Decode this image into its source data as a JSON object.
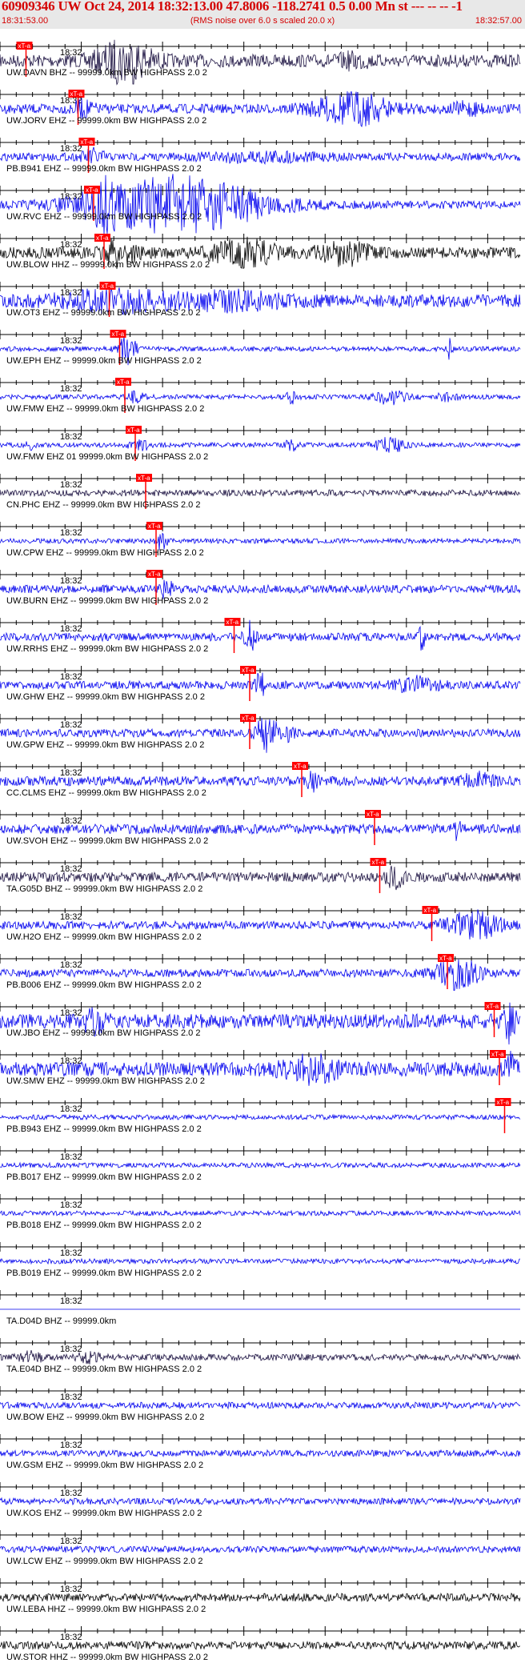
{
  "header": {
    "title": "60909346 UW Oct 24, 2014 18:32:13.00   47.8006 -118.2741  0.5 0.00 Mn st --- -- --  -1",
    "start_time": "18:31:53.00",
    "subtitle": "(RMS noise over 6.0 s scaled 20.0 x)",
    "end_time": "18:32:57.00"
  },
  "colors": {
    "pick": "#ff0000",
    "blue": "#0000ee",
    "dark": "#1a1040",
    "black": "#000000",
    "label": "#000000"
  },
  "chart_data": {
    "type": "line",
    "time_range": [
      "18:31:53.00",
      "18:32:57.00"
    ],
    "tick_label": "18:32",
    "pick_label": "xT-a",
    "series": [
      {
        "station": "UW.DAVN BHZ -- 99999.0km BW  HIGHPASS  2.0  2",
        "color": "dark",
        "pick": 0.05,
        "amp": 8,
        "events": [
          [
            0.24,
            24,
            0.05
          ],
          [
            0.68,
            6,
            0.03
          ]
        ]
      },
      {
        "station": "UW.JORV EHZ -- 99999.0km BW  HIGHPASS  2.0  2",
        "color": "blue",
        "pick": 0.15,
        "amp": 6,
        "events": [
          [
            0.16,
            8,
            0.02
          ],
          [
            0.68,
            18,
            0.07
          ],
          [
            0.9,
            6,
            0.03
          ]
        ]
      },
      {
        "station": "PB.B941 EHZ -- 99999.0km BW  HIGHPASS  2.0  2",
        "color": "blue",
        "pick": 0.17,
        "amp": 5,
        "events": [
          [
            0.18,
            8,
            0.02
          ],
          [
            0.5,
            5,
            0.1
          ]
        ]
      },
      {
        "station": "UW.RVC EHZ -- 99999.0km BW  HIGHPASS  2.0  2",
        "color": "blue",
        "pick": 0.18,
        "amp": 5,
        "events": [
          [
            0.34,
            34,
            0.16
          ],
          [
            0.2,
            20,
            0.03
          ]
        ]
      },
      {
        "station": "UW.BLOW HHZ -- 99999.0km BW  HIGHPASS  2.0  2",
        "color": "black",
        "pick": 0.2,
        "amp": 7,
        "events": [
          [
            0.23,
            16,
            0.03
          ],
          [
            0.47,
            14,
            0.06
          ],
          [
            0.66,
            12,
            0.05
          ]
        ]
      },
      {
        "station": "UW.OT3 EHZ -- 99999.0km BW  HIGHPASS  2.0  2",
        "color": "blue",
        "pick": 0.21,
        "amp": 8,
        "events": [
          [
            0.22,
            10,
            0.1
          ],
          [
            0.45,
            8,
            0.1
          ]
        ]
      },
      {
        "station": "UW.EPH EHZ -- 99999.0km BW  HIGHPASS  2.0  2",
        "color": "blue",
        "pick": 0.23,
        "amp": 3,
        "events": [
          [
            0.245,
            20,
            0.015
          ],
          [
            0.865,
            24,
            0.004
          ]
        ]
      },
      {
        "station": "UW.FMW EHZ -- 99999.0km BW  HIGHPASS  2.0  2",
        "color": "blue",
        "pick": 0.24,
        "amp": 3,
        "events": [
          [
            0.26,
            6,
            0.02
          ],
          [
            0.56,
            7,
            0.01
          ],
          [
            0.75,
            8,
            0.03
          ],
          [
            0.86,
            5,
            0.02
          ]
        ]
      },
      {
        "station": "UW.FMW EHZ 01 99999.0km BW  HIGHPASS  2.0  2",
        "color": "blue",
        "pick": 0.26,
        "amp": 3,
        "events": [
          [
            0.27,
            6,
            0.02
          ],
          [
            0.56,
            7,
            0.01
          ],
          [
            0.75,
            8,
            0.03
          ],
          [
            0.06,
            5,
            0.01
          ]
        ]
      },
      {
        "station": "CN.PHC EHZ -- 99999.0km BW  HIGHPASS  2.0  2",
        "color": "dark",
        "pick": 0.28,
        "amp": 4,
        "events": []
      },
      {
        "station": "UW.CPW EHZ -- 99999.0km BW  HIGHPASS  2.0  2",
        "color": "blue",
        "pick": 0.3,
        "amp": 3,
        "events": [
          [
            0.31,
            10,
            0.01
          ]
        ]
      },
      {
        "station": "UW.BURN EHZ -- 99999.0km BW  HIGHPASS  2.0  2",
        "color": "blue",
        "pick": 0.3,
        "amp": 5,
        "events": [
          [
            0.32,
            12,
            0.01
          ]
        ]
      },
      {
        "station": "UW.RRHS EHZ -- 99999.0km BW  HIGHPASS  2.0  2",
        "color": "blue",
        "pick": 0.45,
        "amp": 5,
        "events": [
          [
            0.48,
            18,
            0.01
          ],
          [
            0.81,
            16,
            0.006
          ]
        ]
      },
      {
        "station": "UW.GHW EHZ -- 99999.0km BW  HIGHPASS  2.0  2",
        "color": "blue",
        "pick": 0.48,
        "amp": 5,
        "events": [
          [
            0.5,
            16,
            0.008
          ],
          [
            0.8,
            8,
            0.04
          ]
        ]
      },
      {
        "station": "UW.GPW EHZ -- 99999.0km BW  HIGHPASS  2.0  2",
        "color": "blue",
        "pick": 0.48,
        "amp": 5,
        "events": [
          [
            0.51,
            20,
            0.02
          ],
          [
            0.55,
            8,
            0.02
          ]
        ]
      },
      {
        "station": "CC.CLMS EHZ -- 99999.0km BW  HIGHPASS  2.0  2",
        "color": "blue",
        "pick": 0.58,
        "amp": 6,
        "events": [
          [
            0.6,
            10,
            0.01
          ],
          [
            0.92,
            8,
            0.03
          ]
        ]
      },
      {
        "station": "UW.SVOH EHZ -- 99999.0km BW  HIGHPASS  2.0  2",
        "color": "blue",
        "pick": 0.72,
        "amp": 6,
        "events": [
          [
            0.88,
            10,
            0.01
          ]
        ]
      },
      {
        "station": "TA.G05D BHZ -- 99999.0km BW  HIGHPASS  2.0  2",
        "color": "dark",
        "pick": 0.73,
        "amp": 6,
        "events": [
          [
            0.76,
            12,
            0.02
          ]
        ]
      },
      {
        "station": "UW.H2O EHZ -- 99999.0km BW  HIGHPASS  2.0  2",
        "color": "blue",
        "pick": 0.83,
        "amp": 5,
        "events": [
          [
            0.91,
            16,
            0.05
          ]
        ]
      },
      {
        "station": "PB.B006 EHZ -- 99999.0km BW  HIGHPASS  2.0  2",
        "color": "blue",
        "pick": 0.86,
        "amp": 5,
        "events": [
          [
            0.88,
            18,
            0.04
          ]
        ]
      },
      {
        "station": "UW.JBO EHZ -- 99999.0km BW  HIGHPASS  2.0  2",
        "color": "blue",
        "pick": 0.95,
        "amp": 9,
        "events": [
          [
            0.18,
            14,
            0.02
          ],
          [
            0.98,
            22,
            0.01
          ]
        ]
      },
      {
        "station": "UW.SMW EHZ -- 99999.0km BW  HIGHPASS  2.0  2",
        "color": "blue",
        "pick": 0.96,
        "amp": 9,
        "events": [
          [
            0.6,
            12,
            0.05
          ],
          [
            0.98,
            20,
            0.01
          ]
        ]
      },
      {
        "station": "PB.B943 EHZ -- 99999.0km BW  HIGHPASS  2.0  2",
        "color": "blue",
        "pick": 0.97,
        "amp": 3,
        "events": []
      },
      {
        "station": "PB.B017 EHZ -- 99999.0km BW  HIGHPASS  2.0  2",
        "color": "blue",
        "pick": null,
        "amp": 3,
        "events": []
      },
      {
        "station": "PB.B018 EHZ -- 99999.0km BW  HIGHPASS  2.0  2",
        "color": "blue",
        "pick": null,
        "amp": 3,
        "events": []
      },
      {
        "station": "PB.B019 EHZ -- 99999.0km BW  HIGHPASS  2.0  2",
        "color": "blue",
        "pick": null,
        "amp": 3,
        "events": []
      },
      {
        "station": "TA.D04D BHZ -- 99999.0km",
        "color": "blue",
        "pick": null,
        "amp": 0,
        "events": []
      },
      {
        "station": "TA.E04D BHZ -- 99999.0km BW  HIGHPASS  2.0  2",
        "color": "dark",
        "pick": null,
        "amp": 4,
        "events": [
          [
            0.06,
            6,
            0.02
          ],
          [
            0.17,
            6,
            0.02
          ]
        ]
      },
      {
        "station": "UW.BOW EHZ -- 99999.0km BW  HIGHPASS  2.0  2",
        "color": "blue",
        "pick": null,
        "amp": 4,
        "events": []
      },
      {
        "station": "UW.GSM EHZ -- 99999.0km BW  HIGHPASS  2.0  2",
        "color": "blue",
        "pick": null,
        "amp": 4,
        "events": []
      },
      {
        "station": "UW.KOS EHZ -- 99999.0km BW  HIGHPASS  2.0  2",
        "color": "blue",
        "pick": null,
        "amp": 4,
        "events": []
      },
      {
        "station": "UW.LCW EHZ -- 99999.0km BW  HIGHPASS  2.0  2",
        "color": "blue",
        "pick": null,
        "amp": 4,
        "events": []
      },
      {
        "station": "UW.LEBA HHZ -- 99999.0km BW  HIGHPASS  2.0  2",
        "color": "black",
        "pick": null,
        "amp": 5,
        "events": []
      },
      {
        "station": "UW.STOR HHZ -- 99999.0km BW  HIGHPASS  2.0  2",
        "color": "black",
        "pick": null,
        "amp": 5,
        "events": []
      }
    ]
  }
}
